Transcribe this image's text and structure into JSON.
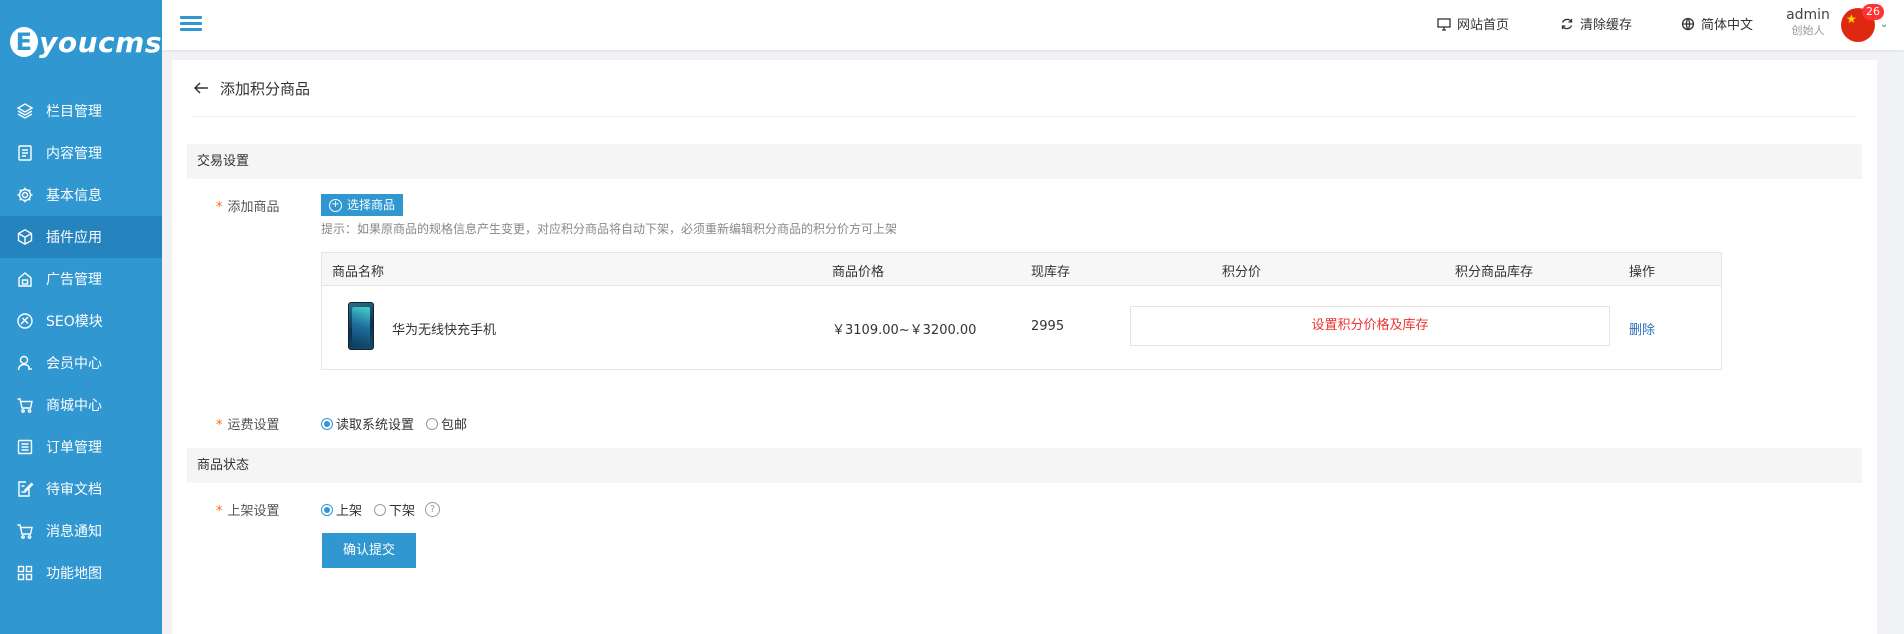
{
  "sidebar": {
    "logo_mark": "E",
    "logo_text": "youcms",
    "items": [
      {
        "label": "栏目管理",
        "icon": "layers-icon"
      },
      {
        "label": "内容管理",
        "icon": "document-icon"
      },
      {
        "label": "基本信息",
        "icon": "gear-icon"
      },
      {
        "label": "插件应用",
        "icon": "cube-icon",
        "active": true
      },
      {
        "label": "广告管理",
        "icon": "ad-icon"
      },
      {
        "label": "SEO模块",
        "icon": "seo-icon"
      },
      {
        "label": "会员中心",
        "icon": "user-icon"
      },
      {
        "label": "商城中心",
        "icon": "cart-icon"
      },
      {
        "label": "订单管理",
        "icon": "list-icon"
      },
      {
        "label": "待审文档",
        "icon": "edit-doc-icon"
      },
      {
        "label": "消息通知",
        "icon": "cart-icon"
      },
      {
        "label": "功能地图",
        "icon": "grid-icon"
      }
    ]
  },
  "header": {
    "site_home": "网站首页",
    "clear_cache": "清除缓存",
    "language": "简体中文",
    "user_name": "admin",
    "user_role": "创始人",
    "badge_count": "26",
    "colors": {
      "accent": "#3097d1",
      "badge": "#ff3333"
    }
  },
  "page": {
    "title": "添加积分商品",
    "section_trade": "交易设置",
    "section_status": "商品状态",
    "add_goods_label": "添加商品",
    "select_goods_button": "选择商品",
    "tip": "提示：如果原商品的规格信息产生变更，对应积分商品将自动下架，必须重新编辑积分商品的积分价方可上架",
    "table": {
      "headers": [
        "商品名称",
        "商品价格",
        "现库存",
        "积分价",
        "积分商品库存",
        "操作"
      ],
      "rows": [
        {
          "name": "华为无线快充手机",
          "price": "￥3109.00~￥3200.00",
          "stock": "2995",
          "set_points": "设置积分价格及库存",
          "action": "删除"
        }
      ]
    },
    "shipping_label": "运费设置",
    "shipping_options": [
      "读取系统设置",
      "包邮"
    ],
    "shipping_selected": 0,
    "listing_label": "上架设置",
    "listing_options": [
      "上架",
      "下架"
    ],
    "listing_selected": 0,
    "help_glyph": "?",
    "submit_button": "确认提交"
  }
}
